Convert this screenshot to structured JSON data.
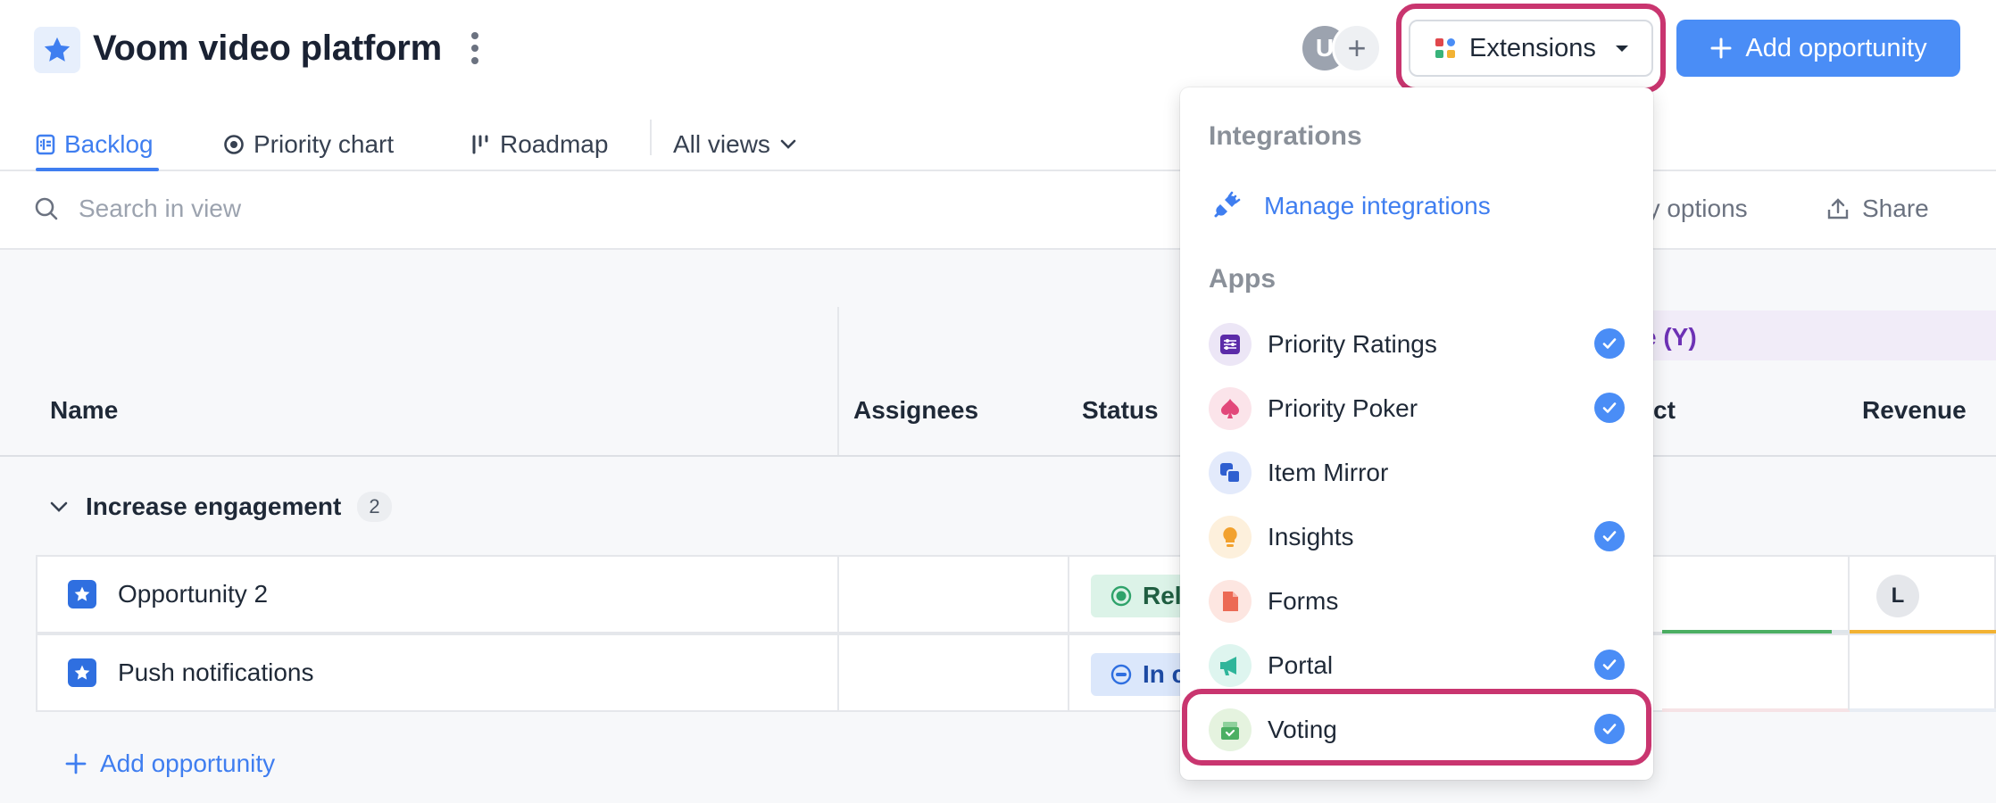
{
  "header": {
    "project_title": "Voom video platform",
    "avatar_initial": "U",
    "add_member_symbol": "+",
    "extensions_label": "Extensions",
    "add_opportunity_label": "Add opportunity"
  },
  "tabs": [
    {
      "label": "Backlog",
      "icon": "backlog-icon",
      "active": true
    },
    {
      "label": "Priority chart",
      "icon": "target-icon",
      "active": false
    },
    {
      "label": "Roadmap",
      "icon": "roadmap-icon",
      "active": false
    },
    {
      "label": "All views",
      "icon": "chevron-down-icon",
      "active": false
    }
  ],
  "toolbar": {
    "search_placeholder": "Search in view",
    "display_options_partial": "ay options",
    "share_label": "Share"
  },
  "table": {
    "y_group_partial": "e (Y)",
    "columns": [
      "Name",
      "Assignees",
      "Status",
      "ct",
      "Revenue"
    ],
    "group": {
      "title": "Increase engagement",
      "count": "2"
    },
    "rows": [
      {
        "name": "Opportunity 2",
        "status_partial": "Rel",
        "assignee_initial": "L"
      },
      {
        "name": "Push notifications",
        "status_partial": "In c"
      }
    ],
    "add_opportunity_label": "Add opportunity"
  },
  "dropdown": {
    "integrations_header": "Integrations",
    "manage_integrations_label": "Manage integrations",
    "apps_header": "Apps",
    "apps": [
      {
        "label": "Priority Ratings",
        "checked": true
      },
      {
        "label": "Priority Poker",
        "checked": true
      },
      {
        "label": "Item Mirror",
        "checked": false
      },
      {
        "label": "Insights",
        "checked": true
      },
      {
        "label": "Forms",
        "checked": false
      },
      {
        "label": "Portal",
        "checked": true
      },
      {
        "label": "Voting",
        "checked": true
      }
    ]
  },
  "colors": {
    "accent": "#4a8df6",
    "highlight": "#c9356f",
    "status_released": "#2fa36b",
    "status_in_progress": "#2f6fe0"
  }
}
